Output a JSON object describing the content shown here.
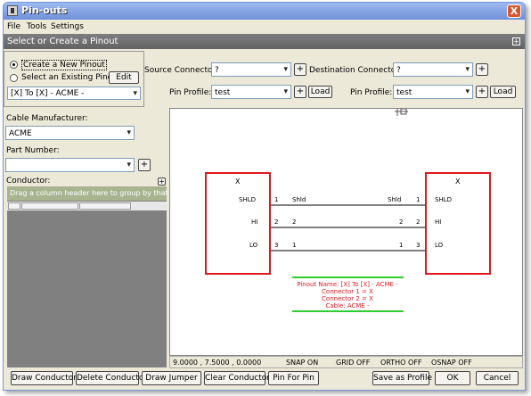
{
  "window": {
    "title": "Pin-outs",
    "close_label": "X"
  },
  "menu": [
    "File",
    "Tools",
    "Settings"
  ],
  "section": {
    "title": "Select or Create a Pinout",
    "expand": "+"
  },
  "pinout_mode": {
    "create_label": "Create a New Pinout",
    "existing_label": "Select an Existing Pinout",
    "selected": "create",
    "edit_label": "Edit",
    "existing_value": "[X] To [X] - ACME -"
  },
  "source": {
    "label": "Source Connector:",
    "value": "?",
    "profile_label": "Pin Profile:",
    "profile_value": "test",
    "load_label": "Load"
  },
  "destination": {
    "label": "Destination Connector:",
    "value": "?",
    "profile_label": "Pin Profile:",
    "profile_value": "test",
    "load_label": "Load"
  },
  "left": {
    "cable_manufacturer_label": "Cable Manufacturer:",
    "cable_manufacturer_value": "ACME",
    "part_number_label": "Part Number:",
    "part_number_value": "",
    "conductor_label": "Conductor:",
    "group_hint": "Drag a column header here to group by that co..."
  },
  "diagram": {
    "left_connector": {
      "name": "X",
      "pins": [
        {
          "label": "SHLD",
          "num": "1"
        },
        {
          "label": "HI",
          "num": "2"
        },
        {
          "label": "LO",
          "num": "3"
        }
      ]
    },
    "right_connector": {
      "name": "X",
      "pins": [
        {
          "label": "SHLD",
          "num": "1"
        },
        {
          "label": "HI",
          "num": "2"
        },
        {
          "label": "LO",
          "num": "3"
        }
      ]
    },
    "wires": [
      {
        "left_text": "Shld",
        "right_text": "Shld"
      },
      {
        "left_text": "2",
        "right_text": "2"
      },
      {
        "left_text": "1",
        "right_text": "1"
      }
    ],
    "info": [
      "Pinout Name: [X] To [X] - ACME -",
      "Connector 1 = X",
      "Connector 2 = X",
      "Cable: ACME -"
    ]
  },
  "status": {
    "coords": "9.0000 , 7.5000 , 0.0000",
    "snap": "SNAP ON",
    "grid": "GRID OFF",
    "ortho": "ORTHO OFF",
    "osnap": "OSNAP OFF"
  },
  "buttons": {
    "draw_conductor": "Draw Conductor",
    "delete_conductor": "Delete Conductor",
    "draw_jumper": "Draw Jumper",
    "clear_conductors": "Clear Conductors",
    "pin_for_pin": "Pin For Pin",
    "save_as_profile": "Save as Profile",
    "ok": "OK",
    "cancel": "Cancel"
  },
  "colors": {
    "connector_border": "#e0181f",
    "info_text": "#e0181f",
    "info_rule": "#2ecc2e",
    "title_bar": "#6f8fd9"
  }
}
